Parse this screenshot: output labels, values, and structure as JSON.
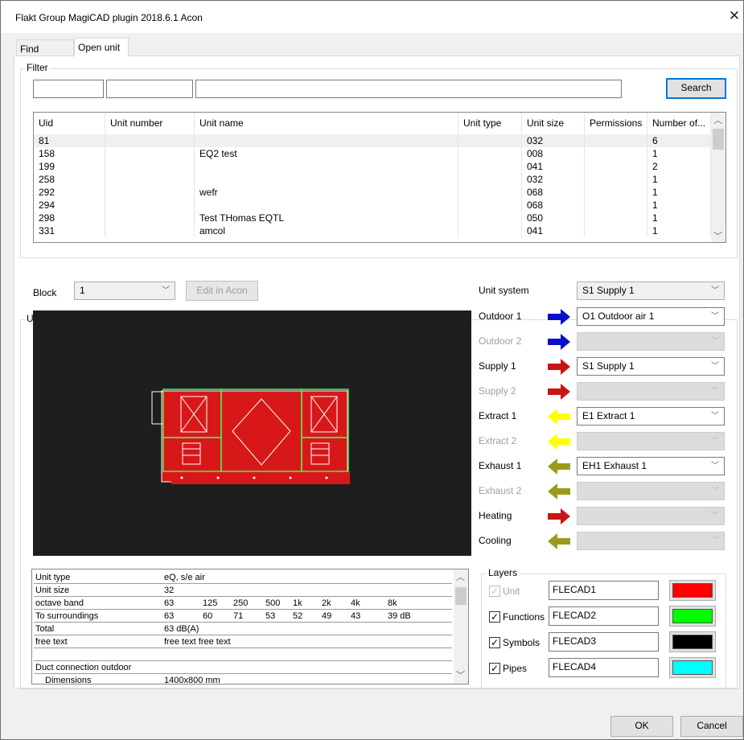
{
  "window": {
    "title": "Flakt Group MagiCAD plugin 2018.6.1 Acon",
    "close_glyph": "✕"
  },
  "tabs": [
    {
      "label": "Find project"
    },
    {
      "label": "Open unit"
    }
  ],
  "filter": {
    "legend": "Filter",
    "field1": "",
    "field2": "",
    "field3": "",
    "search_label": "Search",
    "columns": [
      "Uid",
      "Unit number",
      "Unit name",
      "Unit type",
      "Unit size",
      "Permissions",
      "Number of..."
    ],
    "rows": [
      {
        "uid": "81",
        "unit_number": "",
        "unit_name": "",
        "unit_type": "",
        "unit_size": "032",
        "permissions": "",
        "number": "6"
      },
      {
        "uid": "158",
        "unit_number": "",
        "unit_name": "EQ2 test",
        "unit_type": "",
        "unit_size": "008",
        "permissions": "",
        "number": "1"
      },
      {
        "uid": "199",
        "unit_number": "",
        "unit_name": "",
        "unit_type": "",
        "unit_size": "041",
        "permissions": "",
        "number": "2"
      },
      {
        "uid": "258",
        "unit_number": "",
        "unit_name": "",
        "unit_type": "",
        "unit_size": "032",
        "permissions": "",
        "number": "1"
      },
      {
        "uid": "292",
        "unit_number": "",
        "unit_name": "wefr",
        "unit_type": "",
        "unit_size": "068",
        "permissions": "",
        "number": "1"
      },
      {
        "uid": "294",
        "unit_number": "",
        "unit_name": "",
        "unit_type": "",
        "unit_size": "068",
        "permissions": "",
        "number": "1"
      },
      {
        "uid": "298",
        "unit_number": "",
        "unit_name": "Test THomas EQTL",
        "unit_type": "",
        "unit_size": "050",
        "permissions": "",
        "number": "1"
      },
      {
        "uid": "331",
        "unit_number": "",
        "unit_name": "amcol",
        "unit_type": "",
        "unit_size": "041",
        "permissions": "",
        "number": "1"
      }
    ]
  },
  "block": {
    "label": "Block",
    "value": "1",
    "edit_label": "Edit in Acon"
  },
  "unit_group_legend": "U",
  "systems": {
    "unit_system": {
      "label": "Unit system",
      "value": "S1 Supply 1"
    },
    "rows": [
      {
        "label": "Outdoor 1",
        "enabled": true,
        "arrow_color": "#0a10c8",
        "direction": "right",
        "value": "O1 Outdoor air 1"
      },
      {
        "label": "Outdoor 2",
        "enabled": false,
        "arrow_color": "#0a10c8",
        "direction": "right",
        "value": ""
      },
      {
        "label": "Supply 1",
        "enabled": true,
        "arrow_color": "#c81414",
        "direction": "right",
        "value": "S1 Supply 1"
      },
      {
        "label": "Supply 2",
        "enabled": false,
        "arrow_color": "#c81414",
        "direction": "right",
        "value": ""
      },
      {
        "label": "Extract 1",
        "enabled": true,
        "arrow_color": "#ffff00",
        "direction": "left",
        "value": "E1 Extract 1"
      },
      {
        "label": "Extract 2",
        "enabled": false,
        "arrow_color": "#ffff00",
        "direction": "left",
        "value": ""
      },
      {
        "label": "Exhaust 1",
        "enabled": true,
        "arrow_color": "#9c9a1e",
        "direction": "left",
        "value": "EH1 Exhaust 1"
      },
      {
        "label": "Exhaust 2",
        "enabled": false,
        "arrow_color": "#9c9a1e",
        "direction": "left",
        "value": ""
      },
      {
        "label": "Heating",
        "enabled": true,
        "arrow_color": "#c81414",
        "direction": "right",
        "value": "",
        "combo_disabled": true
      },
      {
        "label": "Cooling",
        "enabled": true,
        "arrow_color": "#9c9a1e",
        "direction": "left",
        "value": "",
        "combo_disabled": true
      }
    ]
  },
  "info_table": {
    "rows": [
      {
        "label": "Unit type",
        "cols": [
          "eQ, s/e air"
        ]
      },
      {
        "label": "Unit size",
        "cols": [
          "32"
        ]
      },
      {
        "label": "octave band",
        "cols": [
          "63",
          "125",
          "250",
          "500",
          "1k",
          "2k",
          "4k",
          "8k"
        ]
      },
      {
        "label": "To surroundings",
        "cols": [
          "63",
          "60",
          "71",
          "53",
          "52",
          "49",
          "43",
          "39 dB"
        ]
      },
      {
        "label": "Total",
        "cols": [
          "63 dB(A)"
        ]
      },
      {
        "label": "free text",
        "cols": [
          "free text free text"
        ]
      },
      {
        "label": "",
        "cols": []
      },
      {
        "label": "Duct connection outdoor",
        "cols": []
      },
      {
        "label": "Dimensions",
        "cols": [
          "1400x800 mm"
        ]
      }
    ]
  },
  "layers": {
    "legend": "Layers",
    "items": [
      {
        "label": "Unit",
        "checked": true,
        "disabled": true,
        "name": "FLECAD1",
        "color": "#ff0000"
      },
      {
        "label": "Functions",
        "checked": true,
        "disabled": false,
        "name": "FLECAD2",
        "color": "#00ff00"
      },
      {
        "label": "Symbols",
        "checked": true,
        "disabled": false,
        "name": "FLECAD3",
        "color": "#000000"
      },
      {
        "label": "Pipes",
        "checked": true,
        "disabled": false,
        "name": "FLECAD4",
        "color": "#00ffff"
      }
    ]
  },
  "footer": {
    "ok_label": "OK",
    "cancel_label": "Cancel"
  }
}
